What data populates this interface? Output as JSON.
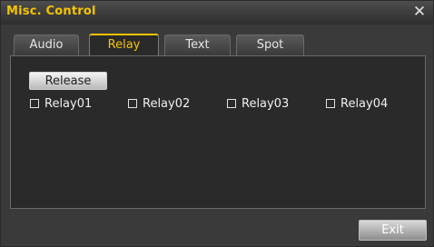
{
  "window": {
    "title": "Misc. Control",
    "close_icon": "close-icon"
  },
  "tabs": [
    {
      "label": "Audio",
      "active": false
    },
    {
      "label": "Relay",
      "active": true
    },
    {
      "label": "Text",
      "active": false
    },
    {
      "label": "Spot",
      "active": false
    }
  ],
  "relay_panel": {
    "release_label": "Release",
    "relays": [
      {
        "label": "Relay01",
        "checked": false
      },
      {
        "label": "Relay02",
        "checked": false
      },
      {
        "label": "Relay03",
        "checked": false
      },
      {
        "label": "Relay04",
        "checked": false
      }
    ]
  },
  "footer": {
    "exit_label": "Exit"
  },
  "colors": {
    "accent": "#f5c400",
    "background": "#3a3a3a",
    "panel": "#2a2a2a"
  }
}
